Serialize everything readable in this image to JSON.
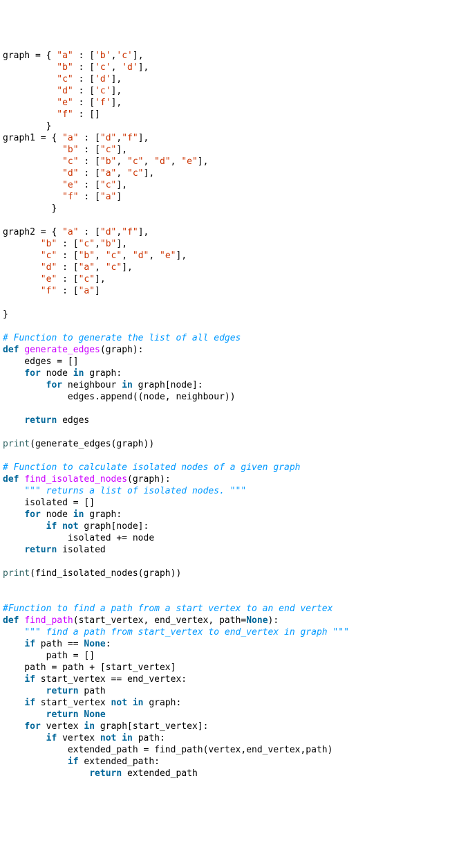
{
  "code": {
    "lines": [
      {
        "t": "raw",
        "segs": [
          [
            "txt",
            "graph = { "
          ],
          [
            "s",
            "\"a\""
          ],
          [
            "txt",
            " : ["
          ],
          [
            "s",
            "'b'"
          ],
          [
            "txt",
            ","
          ],
          [
            "s",
            "'c'"
          ],
          [
            "txt",
            "],"
          ]
        ]
      },
      {
        "t": "raw",
        "segs": [
          [
            "txt",
            "          "
          ],
          [
            "s",
            "\"b\""
          ],
          [
            "txt",
            " : ["
          ],
          [
            "s",
            "'c'"
          ],
          [
            "txt",
            ", "
          ],
          [
            "s",
            "'d'"
          ],
          [
            "txt",
            "],"
          ]
        ]
      },
      {
        "t": "raw",
        "segs": [
          [
            "txt",
            "          "
          ],
          [
            "s",
            "\"c\""
          ],
          [
            "txt",
            " : ["
          ],
          [
            "s",
            "'d'"
          ],
          [
            "txt",
            "],"
          ]
        ]
      },
      {
        "t": "raw",
        "segs": [
          [
            "txt",
            "          "
          ],
          [
            "s",
            "\"d\""
          ],
          [
            "txt",
            " : ["
          ],
          [
            "s",
            "'c'"
          ],
          [
            "txt",
            "],"
          ]
        ]
      },
      {
        "t": "raw",
        "segs": [
          [
            "txt",
            "          "
          ],
          [
            "s",
            "\"e\""
          ],
          [
            "txt",
            " : ["
          ],
          [
            "s",
            "'f'"
          ],
          [
            "txt",
            "],"
          ]
        ]
      },
      {
        "t": "raw",
        "segs": [
          [
            "txt",
            "          "
          ],
          [
            "s",
            "\"f\""
          ],
          [
            "txt",
            " : []"
          ]
        ]
      },
      {
        "t": "raw",
        "segs": [
          [
            "txt",
            "        }"
          ]
        ]
      },
      {
        "t": "raw",
        "segs": [
          [
            "txt",
            "graph1 = { "
          ],
          [
            "s",
            "\"a\""
          ],
          [
            "txt",
            " : ["
          ],
          [
            "s",
            "\"d\""
          ],
          [
            "txt",
            ","
          ],
          [
            "s",
            "\"f\""
          ],
          [
            "txt",
            "],"
          ]
        ]
      },
      {
        "t": "raw",
        "segs": [
          [
            "txt",
            "           "
          ],
          [
            "s",
            "\"b\""
          ],
          [
            "txt",
            " : ["
          ],
          [
            "s",
            "\"c\""
          ],
          [
            "txt",
            "],"
          ]
        ]
      },
      {
        "t": "raw",
        "segs": [
          [
            "txt",
            "           "
          ],
          [
            "s",
            "\"c\""
          ],
          [
            "txt",
            " : ["
          ],
          [
            "s",
            "\"b\""
          ],
          [
            "txt",
            ", "
          ],
          [
            "s",
            "\"c\""
          ],
          [
            "txt",
            ", "
          ],
          [
            "s",
            "\"d\""
          ],
          [
            "txt",
            ", "
          ],
          [
            "s",
            "\"e\""
          ],
          [
            "txt",
            "],"
          ]
        ]
      },
      {
        "t": "raw",
        "segs": [
          [
            "txt",
            "           "
          ],
          [
            "s",
            "\"d\""
          ],
          [
            "txt",
            " : ["
          ],
          [
            "s",
            "\"a\""
          ],
          [
            "txt",
            ", "
          ],
          [
            "s",
            "\"c\""
          ],
          [
            "txt",
            "],"
          ]
        ]
      },
      {
        "t": "raw",
        "segs": [
          [
            "txt",
            "           "
          ],
          [
            "s",
            "\"e\""
          ],
          [
            "txt",
            " : ["
          ],
          [
            "s",
            "\"c\""
          ],
          [
            "txt",
            "],"
          ]
        ]
      },
      {
        "t": "raw",
        "segs": [
          [
            "txt",
            "           "
          ],
          [
            "s",
            "\"f\""
          ],
          [
            "txt",
            " : ["
          ],
          [
            "s",
            "\"a\""
          ],
          [
            "txt",
            "]"
          ]
        ]
      },
      {
        "t": "raw",
        "segs": [
          [
            "txt",
            "         }"
          ]
        ]
      },
      {
        "t": "blank",
        "segs": []
      },
      {
        "t": "raw",
        "segs": [
          [
            "txt",
            "graph2 = { "
          ],
          [
            "s",
            "\"a\""
          ],
          [
            "txt",
            " : ["
          ],
          [
            "s",
            "\"d\""
          ],
          [
            "txt",
            ","
          ],
          [
            "s",
            "\"f\""
          ],
          [
            "txt",
            "],"
          ]
        ]
      },
      {
        "t": "raw",
        "segs": [
          [
            "txt",
            "       "
          ],
          [
            "s",
            "\"b\""
          ],
          [
            "txt",
            " : ["
          ],
          [
            "s",
            "\"c\""
          ],
          [
            "txt",
            ","
          ],
          [
            "s",
            "\"b\""
          ],
          [
            "txt",
            "],"
          ]
        ]
      },
      {
        "t": "raw",
        "segs": [
          [
            "txt",
            "       "
          ],
          [
            "s",
            "\"c\""
          ],
          [
            "txt",
            " : ["
          ],
          [
            "s",
            "\"b\""
          ],
          [
            "txt",
            ", "
          ],
          [
            "s",
            "\"c\""
          ],
          [
            "txt",
            ", "
          ],
          [
            "s",
            "\"d\""
          ],
          [
            "txt",
            ", "
          ],
          [
            "s",
            "\"e\""
          ],
          [
            "txt",
            "],"
          ]
        ]
      },
      {
        "t": "raw",
        "segs": [
          [
            "txt",
            "       "
          ],
          [
            "s",
            "\"d\""
          ],
          [
            "txt",
            " : ["
          ],
          [
            "s",
            "\"a\""
          ],
          [
            "txt",
            ", "
          ],
          [
            "s",
            "\"c\""
          ],
          [
            "txt",
            "],"
          ]
        ]
      },
      {
        "t": "raw",
        "segs": [
          [
            "txt",
            "       "
          ],
          [
            "s",
            "\"e\""
          ],
          [
            "txt",
            " : ["
          ],
          [
            "s",
            "\"c\""
          ],
          [
            "txt",
            "],"
          ]
        ]
      },
      {
        "t": "raw",
        "segs": [
          [
            "txt",
            "       "
          ],
          [
            "s",
            "\"f\""
          ],
          [
            "txt",
            " : ["
          ],
          [
            "s",
            "\"a\""
          ],
          [
            "txt",
            "]"
          ]
        ]
      },
      {
        "t": "blank",
        "segs": []
      },
      {
        "t": "raw",
        "segs": [
          [
            "txt",
            "}"
          ]
        ]
      },
      {
        "t": "blank",
        "segs": []
      },
      {
        "t": "raw",
        "segs": [
          [
            "c",
            "# Function to generate the list of all edges"
          ]
        ]
      },
      {
        "t": "raw",
        "segs": [
          [
            "k",
            "def"
          ],
          [
            "txt",
            " "
          ],
          [
            "nf",
            "generate_edges"
          ],
          [
            "txt",
            "(graph):"
          ]
        ]
      },
      {
        "t": "raw",
        "segs": [
          [
            "txt",
            "    edges = []"
          ]
        ]
      },
      {
        "t": "raw",
        "segs": [
          [
            "txt",
            "    "
          ],
          [
            "k",
            "for"
          ],
          [
            "txt",
            " node "
          ],
          [
            "k",
            "in"
          ],
          [
            "txt",
            " graph:"
          ]
        ]
      },
      {
        "t": "raw",
        "segs": [
          [
            "txt",
            "        "
          ],
          [
            "k",
            "for"
          ],
          [
            "txt",
            " neighbour "
          ],
          [
            "k",
            "in"
          ],
          [
            "txt",
            " graph[node]:"
          ]
        ]
      },
      {
        "t": "raw",
        "segs": [
          [
            "txt",
            "            edges.append((node, neighbour))"
          ]
        ]
      },
      {
        "t": "blank",
        "segs": []
      },
      {
        "t": "raw",
        "segs": [
          [
            "txt",
            "    "
          ],
          [
            "k",
            "return"
          ],
          [
            "txt",
            " edges"
          ]
        ]
      },
      {
        "t": "blank",
        "segs": []
      },
      {
        "t": "raw",
        "segs": [
          [
            "bn",
            "print"
          ],
          [
            "txt",
            "(generate_edges(graph))"
          ]
        ]
      },
      {
        "t": "blank",
        "segs": []
      },
      {
        "t": "raw",
        "segs": [
          [
            "c",
            "# Function to calculate isolated nodes of a given graph"
          ]
        ]
      },
      {
        "t": "raw",
        "segs": [
          [
            "k",
            "def"
          ],
          [
            "txt",
            " "
          ],
          [
            "nf",
            "find_isolated_nodes"
          ],
          [
            "txt",
            "(graph):"
          ]
        ]
      },
      {
        "t": "raw",
        "segs": [
          [
            "txt",
            "    "
          ],
          [
            "c",
            "\"\"\" returns a list of isolated nodes. \"\"\""
          ]
        ]
      },
      {
        "t": "raw",
        "segs": [
          [
            "txt",
            "    isolated = []"
          ]
        ]
      },
      {
        "t": "raw",
        "segs": [
          [
            "txt",
            "    "
          ],
          [
            "k",
            "for"
          ],
          [
            "txt",
            " node "
          ],
          [
            "k",
            "in"
          ],
          [
            "txt",
            " graph:"
          ]
        ]
      },
      {
        "t": "raw",
        "segs": [
          [
            "txt",
            "        "
          ],
          [
            "k",
            "if"
          ],
          [
            "txt",
            " "
          ],
          [
            "k",
            "not"
          ],
          [
            "txt",
            " graph[node]:"
          ]
        ]
      },
      {
        "t": "raw",
        "segs": [
          [
            "txt",
            "            isolated += node"
          ]
        ]
      },
      {
        "t": "raw",
        "segs": [
          [
            "txt",
            "    "
          ],
          [
            "k",
            "return"
          ],
          [
            "txt",
            " isolated"
          ]
        ]
      },
      {
        "t": "blank",
        "segs": []
      },
      {
        "t": "raw",
        "segs": [
          [
            "bn",
            "print"
          ],
          [
            "txt",
            "(find_isolated_nodes(graph))"
          ]
        ]
      },
      {
        "t": "blank",
        "segs": []
      },
      {
        "t": "blank",
        "segs": []
      },
      {
        "t": "raw",
        "segs": [
          [
            "c",
            "#Function to find a path from a start vertex to an end vertex"
          ]
        ]
      },
      {
        "t": "raw",
        "segs": [
          [
            "k",
            "def"
          ],
          [
            "txt",
            " "
          ],
          [
            "nf",
            "find_path"
          ],
          [
            "txt",
            "(start_vertex, end_vertex, path="
          ],
          [
            "kn",
            "None"
          ],
          [
            "txt",
            "):"
          ]
        ]
      },
      {
        "t": "raw",
        "segs": [
          [
            "txt",
            "    "
          ],
          [
            "c",
            "\"\"\" find a path from start_vertex to end_vertex in graph \"\"\""
          ]
        ]
      },
      {
        "t": "raw",
        "segs": [
          [
            "txt",
            "    "
          ],
          [
            "k",
            "if"
          ],
          [
            "txt",
            " path == "
          ],
          [
            "kn",
            "None"
          ],
          [
            "txt",
            ":"
          ]
        ]
      },
      {
        "t": "raw",
        "segs": [
          [
            "txt",
            "        path = []"
          ]
        ]
      },
      {
        "t": "raw",
        "segs": [
          [
            "txt",
            "    path = path + [start_vertex]"
          ]
        ]
      },
      {
        "t": "raw",
        "segs": [
          [
            "txt",
            "    "
          ],
          [
            "k",
            "if"
          ],
          [
            "txt",
            " start_vertex == end_vertex:"
          ]
        ]
      },
      {
        "t": "raw",
        "segs": [
          [
            "txt",
            "        "
          ],
          [
            "k",
            "return"
          ],
          [
            "txt",
            " path"
          ]
        ]
      },
      {
        "t": "raw",
        "segs": [
          [
            "txt",
            "    "
          ],
          [
            "k",
            "if"
          ],
          [
            "txt",
            " start_vertex "
          ],
          [
            "k",
            "not"
          ],
          [
            "txt",
            " "
          ],
          [
            "k",
            "in"
          ],
          [
            "txt",
            " graph:"
          ]
        ]
      },
      {
        "t": "raw",
        "segs": [
          [
            "txt",
            "        "
          ],
          [
            "k",
            "return"
          ],
          [
            "txt",
            " "
          ],
          [
            "kn",
            "None"
          ]
        ]
      },
      {
        "t": "raw",
        "segs": [
          [
            "txt",
            "    "
          ],
          [
            "k",
            "for"
          ],
          [
            "txt",
            " vertex "
          ],
          [
            "k",
            "in"
          ],
          [
            "txt",
            " graph[start_vertex]:"
          ]
        ]
      },
      {
        "t": "raw",
        "segs": [
          [
            "txt",
            "        "
          ],
          [
            "k",
            "if"
          ],
          [
            "txt",
            " vertex "
          ],
          [
            "k",
            "not"
          ],
          [
            "txt",
            " "
          ],
          [
            "k",
            "in"
          ],
          [
            "txt",
            " path:"
          ]
        ]
      },
      {
        "t": "raw",
        "segs": [
          [
            "txt",
            "            extended_path = find_path(vertex,end_vertex,path)"
          ]
        ]
      },
      {
        "t": "raw",
        "segs": [
          [
            "txt",
            "            "
          ],
          [
            "k",
            "if"
          ],
          [
            "txt",
            " extended_path:"
          ]
        ]
      },
      {
        "t": "raw",
        "segs": [
          [
            "txt",
            "                "
          ],
          [
            "k",
            "return"
          ],
          [
            "txt",
            " extended_path"
          ]
        ]
      }
    ]
  }
}
